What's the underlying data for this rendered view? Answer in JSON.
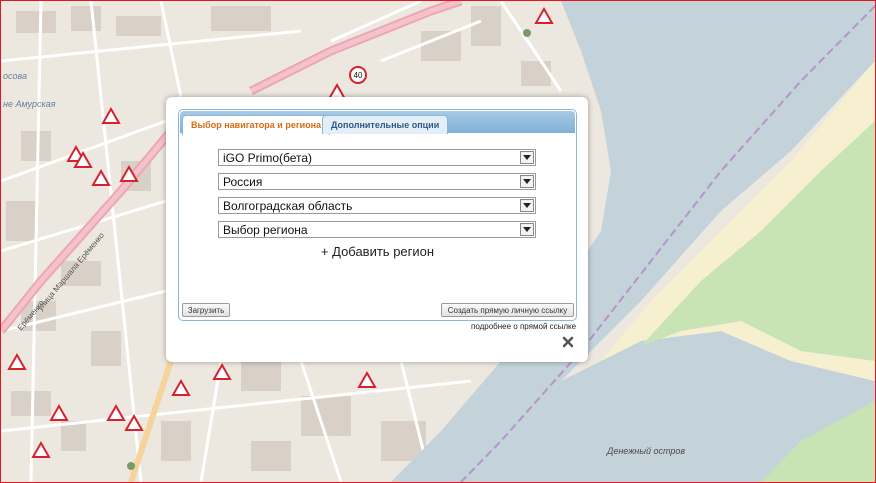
{
  "map": {
    "labels": {
      "amur": "не Амурская",
      "moscow": "осова",
      "island": "Денежный остров",
      "street": "улица Маршала Ерёменко",
      "street_short": "Ерёменко",
      "speed": "40"
    },
    "colors": {
      "water": "#c4d3da",
      "park": "#c8e3b4",
      "sand": "#f6efd0",
      "road": "#f9f9f9",
      "main_road": "#eca7b3",
      "building": "#d9d0c7",
      "boundary": "#b594c9"
    },
    "icons": [
      "road-sign-icon",
      "speed-limit-icon",
      "pedestrian-icon"
    ]
  },
  "dialog": {
    "tabs": [
      {
        "label": "Выбор навигатора и региона",
        "active": true
      },
      {
        "label": "Дополнительные опции",
        "active": false
      }
    ],
    "selects": [
      {
        "value": "iGO Primo(бета)"
      },
      {
        "value": "Россия"
      },
      {
        "value": "Волгоградская область"
      },
      {
        "value": "Выбор региона"
      }
    ],
    "add_region_label": "+ Добавить регион",
    "load_button": "Загрузить",
    "link_button": "Создать прямую личную ссылку",
    "link_more": "подробнее о прямой ссылке",
    "close_icon": "close-icon",
    "colors": {
      "active_tab_text": "#d86a10",
      "tab_bar": "#8fb5d6"
    }
  }
}
